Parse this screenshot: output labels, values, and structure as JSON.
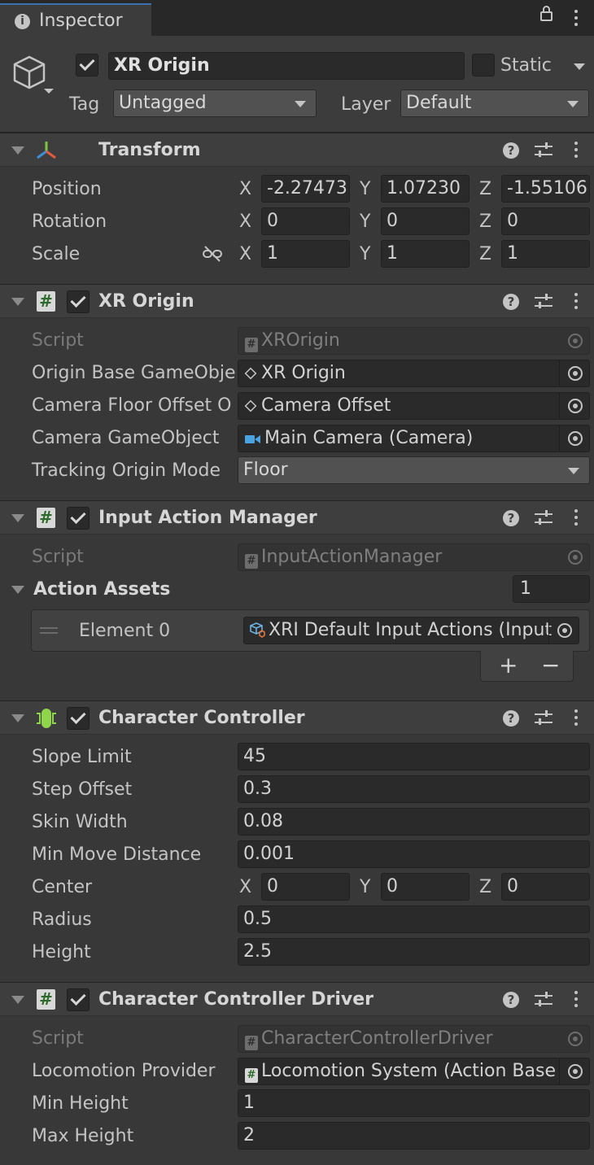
{
  "tab": {
    "label": "Inspector"
  },
  "object": {
    "name": "XR Origin",
    "static_label": "Static",
    "tag_label": "Tag",
    "tag_value": "Untagged",
    "layer_label": "Layer",
    "layer_value": "Default"
  },
  "transform": {
    "title": "Transform",
    "position": {
      "label": "Position",
      "x": "-2.27473",
      "y": "1.07230",
      "z": "-1.55106"
    },
    "rotation": {
      "label": "Rotation",
      "x": "0",
      "y": "0",
      "z": "0"
    },
    "scale": {
      "label": "Scale",
      "x": "1",
      "y": "1",
      "z": "1"
    },
    "axes": {
      "x": "X",
      "y": "Y",
      "z": "Z"
    }
  },
  "xr_origin": {
    "title": "XR Origin",
    "script_label": "Script",
    "script_value": "XROrigin",
    "origin_base_label": "Origin Base GameObje",
    "origin_base_value": "XR Origin",
    "camera_floor_label": "Camera Floor Offset O",
    "camera_floor_value": "Camera Offset",
    "camera_go_label": "Camera GameObject",
    "camera_go_value": "Main Camera (Camera)",
    "tracking_label": "Tracking Origin Mode",
    "tracking_value": "Floor"
  },
  "input_action_manager": {
    "title": "Input Action Manager",
    "script_label": "Script",
    "script_value": "InputActionManager",
    "assets_label": "Action Assets",
    "assets_count": "1",
    "element_label": "Element 0",
    "element_value": "XRI Default Input Actions (Input",
    "add_label": "+",
    "remove_label": "−"
  },
  "character_controller": {
    "title": "Character Controller",
    "slope_label": "Slope Limit",
    "slope_value": "45",
    "step_label": "Step Offset",
    "step_value": "0.3",
    "skin_label": "Skin Width",
    "skin_value": "0.08",
    "min_move_label": "Min Move Distance",
    "min_move_value": "0.001",
    "center_label": "Center",
    "center_x": "0",
    "center_y": "0",
    "center_z": "0",
    "radius_label": "Radius",
    "radius_value": "0.5",
    "height_label": "Height",
    "height_value": "2.5"
  },
  "ccd": {
    "title": "Character Controller Driver",
    "script_label": "Script",
    "script_value": "CharacterControllerDriver",
    "loco_label": "Locomotion Provider",
    "loco_value": "Locomotion System (Action Base",
    "min_h_label": "Min Height",
    "min_h_value": "1",
    "max_h_label": "Max Height",
    "max_h_value": "2"
  }
}
